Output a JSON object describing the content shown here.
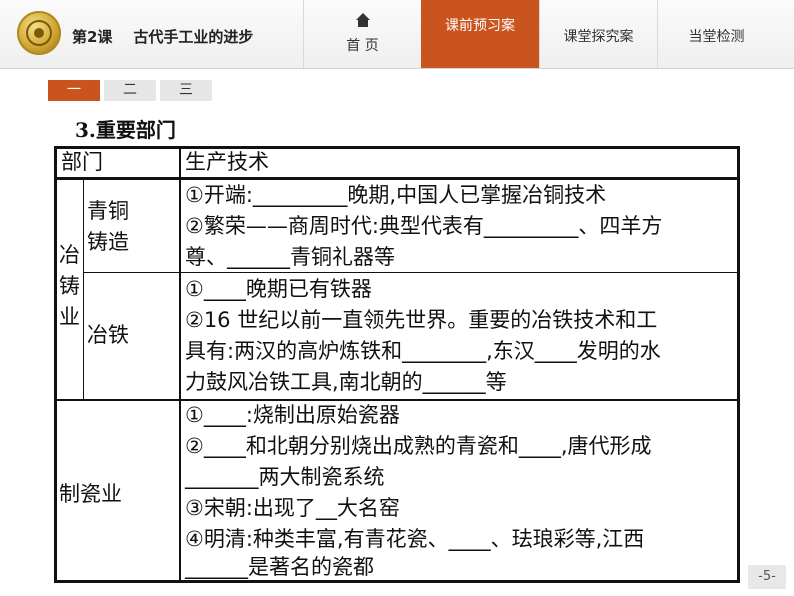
{
  "header": {
    "lesson_title": "第2课    古代手工业的进步",
    "nav": {
      "home": "首  页",
      "preview": "课前预习案",
      "explore": "课堂探究案",
      "check": "当堂检测"
    }
  },
  "subtabs": [
    "一",
    "二",
    "三"
  ],
  "section_title": "3.重要部门",
  "table": {
    "header": {
      "dept": "部门",
      "tech": "生产技术"
    },
    "metallurgy": {
      "group_label": [
        "冶",
        "铸",
        "业"
      ],
      "bronze_label": [
        "青铜",
        "铸造"
      ],
      "bronze_lines": [
        "①开端:_________晚期,中国人已掌握冶铜技术",
        "②繁荣——商周时代:典型代表有_________、四羊方",
        "尊、______青铜礼器等"
      ],
      "iron_label": "冶铁",
      "iron_lines": [
        "①____晚期已有铁器",
        "②16 世纪以前一直领先世界。重要的冶铁技术和工",
        "具有:两汉的高炉炼铁和________,东汉____发明的水",
        "力鼓风冶铁工具,南北朝的______等"
      ]
    },
    "porcelain": {
      "label": "制瓷业",
      "lines": [
        "①____:烧制出原始瓷器",
        "②____和北朝分别烧出成熟的青瓷和____,唐代形成",
        "_______两大制瓷系统",
        "③宋朝:出现了__大名窑",
        "④明清:种类丰富,有青花瓷、____、珐琅彩等,江西",
        "______是著名的瓷都"
      ]
    }
  },
  "page_number": "-5-"
}
